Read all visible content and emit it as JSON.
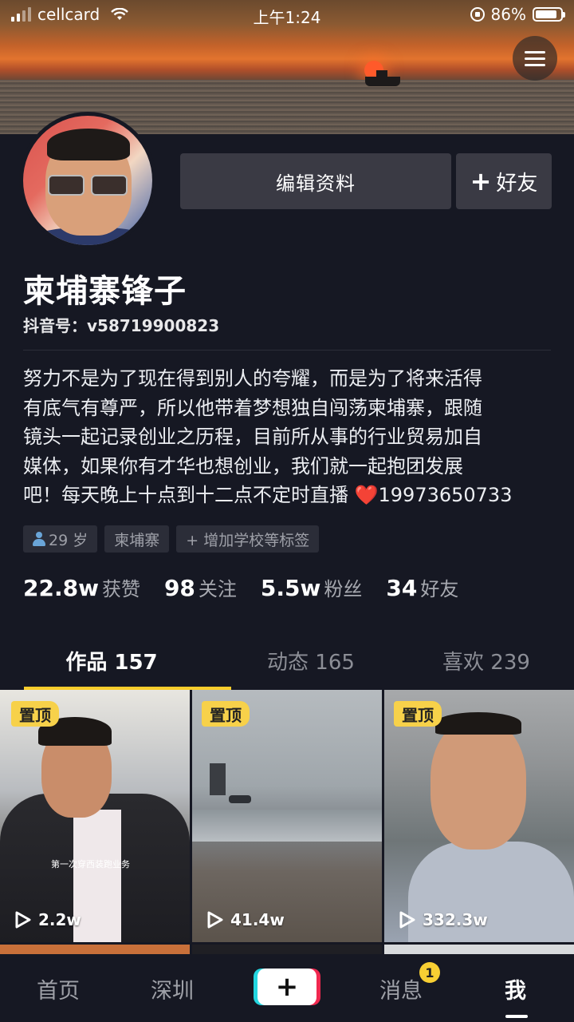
{
  "status_bar": {
    "carrier": "cellcard",
    "time": "上午1:24",
    "battery": "86%",
    "battery_level": 0.86
  },
  "profile": {
    "name": "柬埔寨锋子",
    "douyin_id": "抖音号：v58719900823",
    "edit_button": "编辑资料",
    "add_friend_button": "好友",
    "bio_lines": [
      "努力不是为了现在得到别人的夸耀，而是为了将来活得",
      "有底气有尊严，所以他带着梦想独自闯荡柬埔寨，跟随",
      "镜头一起记录创业之历程，目前所从事的行业贸易加自",
      "媒体，如果你有才华也想创业，我们就一起抱团发展",
      "吧！每天晚上十点到十二点不定时直播 ❤️19973650733"
    ],
    "tags": {
      "age": "29 岁",
      "location": "柬埔寨",
      "add_school": "+ 增加学校等标签"
    }
  },
  "stats": [
    {
      "value": "22.8w",
      "label": "获赞"
    },
    {
      "value": "98",
      "label": "关注"
    },
    {
      "value": "5.5w",
      "label": "粉丝"
    },
    {
      "value": "34",
      "label": "好友"
    }
  ],
  "tabs": [
    {
      "label": "作品 157"
    },
    {
      "label": "动态 165"
    },
    {
      "label": "喜欢 239"
    }
  ],
  "videos": [
    {
      "pin": "置顶",
      "plays": "2.2w",
      "caption": "第一次穿西装跑业务"
    },
    {
      "pin": "置顶",
      "plays": "41.4w"
    },
    {
      "pin": "置顶",
      "plays": "332.3w"
    }
  ],
  "bottom_nav": {
    "home": "首页",
    "city": "深圳",
    "create": "+",
    "messages": "消息",
    "messages_badge": "1",
    "me": "我"
  },
  "colors": {
    "background": "#161823",
    "accent_yellow": "#facd2c",
    "button_bg": "#3a3a44"
  },
  "icons": [
    "menu-icon",
    "plus-icon",
    "person-icon",
    "play-icon",
    "heart-icon",
    "wifi-icon",
    "battery-icon"
  ]
}
